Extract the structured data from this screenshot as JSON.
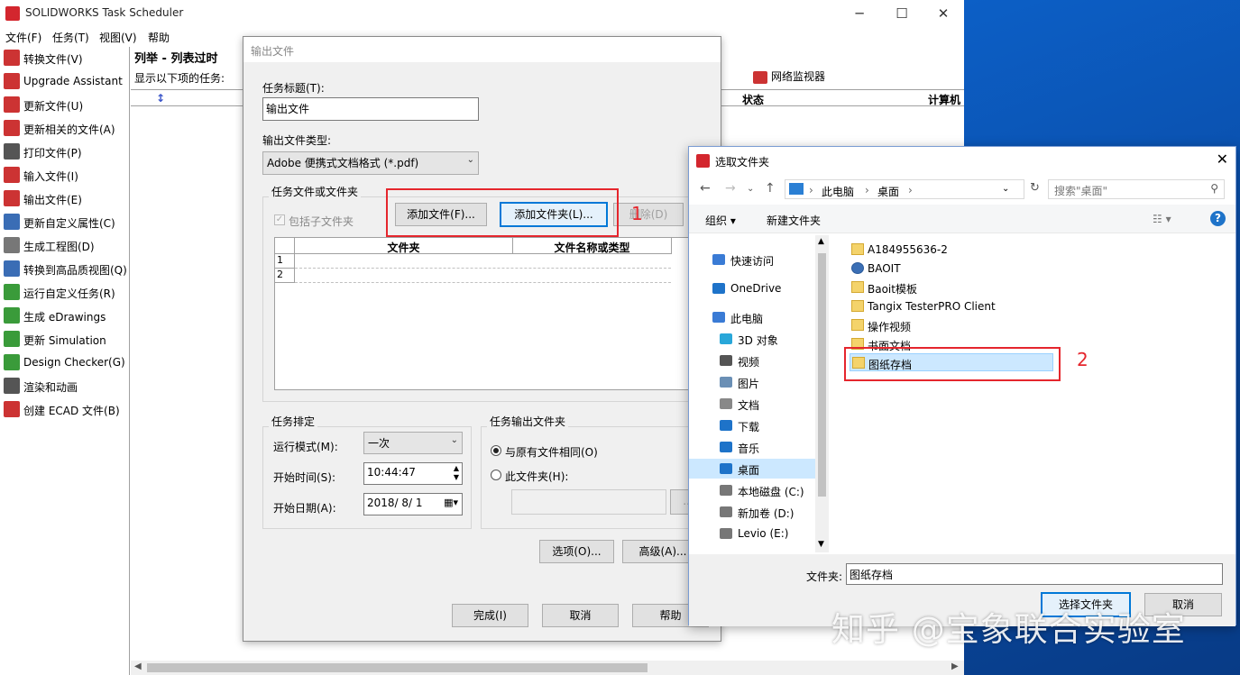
{
  "main_window": {
    "title": "SOLIDWORKS Task Scheduler",
    "menu": [
      "文件(F)",
      "任务(T)",
      "视图(V)",
      "帮助"
    ],
    "sidebar": [
      {
        "label": "转换文件(V)",
        "icon": "convert-icon",
        "color": "#c33"
      },
      {
        "label": "Upgrade Assistant",
        "icon": "upgrade-icon",
        "color": "#c33"
      },
      {
        "label": "更新文件(U)",
        "icon": "update-icon",
        "color": "#c33"
      },
      {
        "label": "更新相关的文件(A)",
        "icon": "update-related-icon",
        "color": "#c33"
      },
      {
        "label": "打印文件(P)",
        "icon": "print-icon",
        "color": "#555"
      },
      {
        "label": "输入文件(I)",
        "icon": "import-icon",
        "color": "#c33"
      },
      {
        "label": "输出文件(E)",
        "icon": "export-icon",
        "color": "#c33"
      },
      {
        "label": "更新自定义属性(C)",
        "icon": "properties-icon",
        "color": "#3a6db5"
      },
      {
        "label": "生成工程图(D)",
        "icon": "drawing-icon",
        "color": "#777"
      },
      {
        "label": "转换到高品质视图(Q)",
        "icon": "view-icon",
        "color": "#3a6db5"
      },
      {
        "label": "运行自定义任务(R)",
        "icon": "custom-task-icon",
        "color": "#3a9b3a"
      },
      {
        "label": "生成 eDrawings",
        "icon": "edrawings-icon",
        "color": "#3a9b3a"
      },
      {
        "label": "更新 Simulation",
        "icon": "simulation-icon",
        "color": "#3a9b3a"
      },
      {
        "label": "Design Checker(G)",
        "icon": "checker-icon",
        "color": "#3a9b3a"
      },
      {
        "label": "渲染和动画",
        "icon": "render-icon",
        "color": "#555"
      },
      {
        "label": "创建 ECAD 文件(B)",
        "icon": "ecad-icon",
        "color": "#c33"
      }
    ],
    "list_title": "列举 - 列表过时",
    "show_label": "显示以下项的任务:",
    "network_monitor": "网络监视器",
    "columns": {
      "status": "状态",
      "computer": "计算机"
    }
  },
  "output_dialog": {
    "title": "输出文件",
    "task_title_label": "任务标题(T):",
    "task_title_value": "输出文件",
    "file_type_label": "输出文件类型:",
    "file_type_value": "Adobe 便携式文档格式 (*.pdf)",
    "group_files": "任务文件或文件夹",
    "include_subfolders": "包括子文件夹",
    "add_file": "添加文件(F)...",
    "add_folder": "添加文件夹(L)...",
    "delete": "删除(D)",
    "table_headers": [
      "文件夹",
      "文件名称或类型"
    ],
    "rows": [
      "1",
      "2"
    ],
    "group_schedule": "任务排定",
    "run_mode_label": "运行模式(M):",
    "run_mode_value": "一次",
    "start_time_label": "开始时间(S):",
    "start_time_value": "10:44:47",
    "start_date_label": "开始日期(A):",
    "start_date_value": "2018/ 8/ 1",
    "group_output": "任务输出文件夹",
    "radio_same": "与原有文件相同(O)",
    "radio_folder": "此文件夹(H):",
    "options": "选项(O)...",
    "advanced": "高级(A)...",
    "finish": "完成(I)",
    "cancel": "取消",
    "help": "帮助",
    "annotation_1": "1"
  },
  "folder_dialog": {
    "title": "选取文件夹",
    "breadcrumb": [
      "此电脑",
      "桌面"
    ],
    "search_placeholder": "搜索\"桌面\"",
    "organize": "组织 ▾",
    "new_folder": "新建文件夹",
    "nav": [
      {
        "label": "快速访问",
        "icon": "star-icon",
        "color": "#3a7bd5",
        "indent": 0
      },
      {
        "label": "OneDrive",
        "icon": "cloud-icon",
        "color": "#1e73c9",
        "indent": 0
      },
      {
        "label": "此电脑",
        "icon": "computer-icon",
        "color": "#3a7bd5",
        "indent": 0
      },
      {
        "label": "3D 对象",
        "icon": "3d-objects-icon",
        "color": "#29a7d9",
        "indent": 1
      },
      {
        "label": "视频",
        "icon": "video-icon",
        "color": "#555",
        "indent": 1
      },
      {
        "label": "图片",
        "icon": "pictures-icon",
        "color": "#6a8fb5",
        "indent": 1
      },
      {
        "label": "文档",
        "icon": "documents-icon",
        "color": "#888",
        "indent": 1
      },
      {
        "label": "下载",
        "icon": "download-icon",
        "color": "#1e73c9",
        "indent": 1
      },
      {
        "label": "音乐",
        "icon": "music-icon",
        "color": "#1e73c9",
        "indent": 1
      },
      {
        "label": "桌面",
        "icon": "desktop-icon",
        "color": "#1e73c9",
        "indent": 1,
        "selected": true
      },
      {
        "label": "本地磁盘 (C:)",
        "icon": "drive-c-icon",
        "color": "#777",
        "indent": 1
      },
      {
        "label": "新加卷 (D:)",
        "icon": "drive-d-icon",
        "color": "#777",
        "indent": 1
      },
      {
        "label": "Levio (E:)",
        "icon": "drive-e-icon",
        "color": "#777",
        "indent": 1
      }
    ],
    "files": [
      {
        "label": "A184955636-2"
      },
      {
        "label": "BAOIT"
      },
      {
        "label": "Baoit模板"
      },
      {
        "label": "Tangix TesterPRO Client"
      },
      {
        "label": "操作视频"
      },
      {
        "label": "书面文档"
      },
      {
        "label": "图纸存档",
        "selected": true
      }
    ],
    "folder_label": "文件夹:",
    "folder_value": "图纸存档",
    "select_button": "选择文件夹",
    "cancel_button": "取消",
    "annotation_2": "2"
  },
  "watermark": "知乎 @宝象联合实验室"
}
